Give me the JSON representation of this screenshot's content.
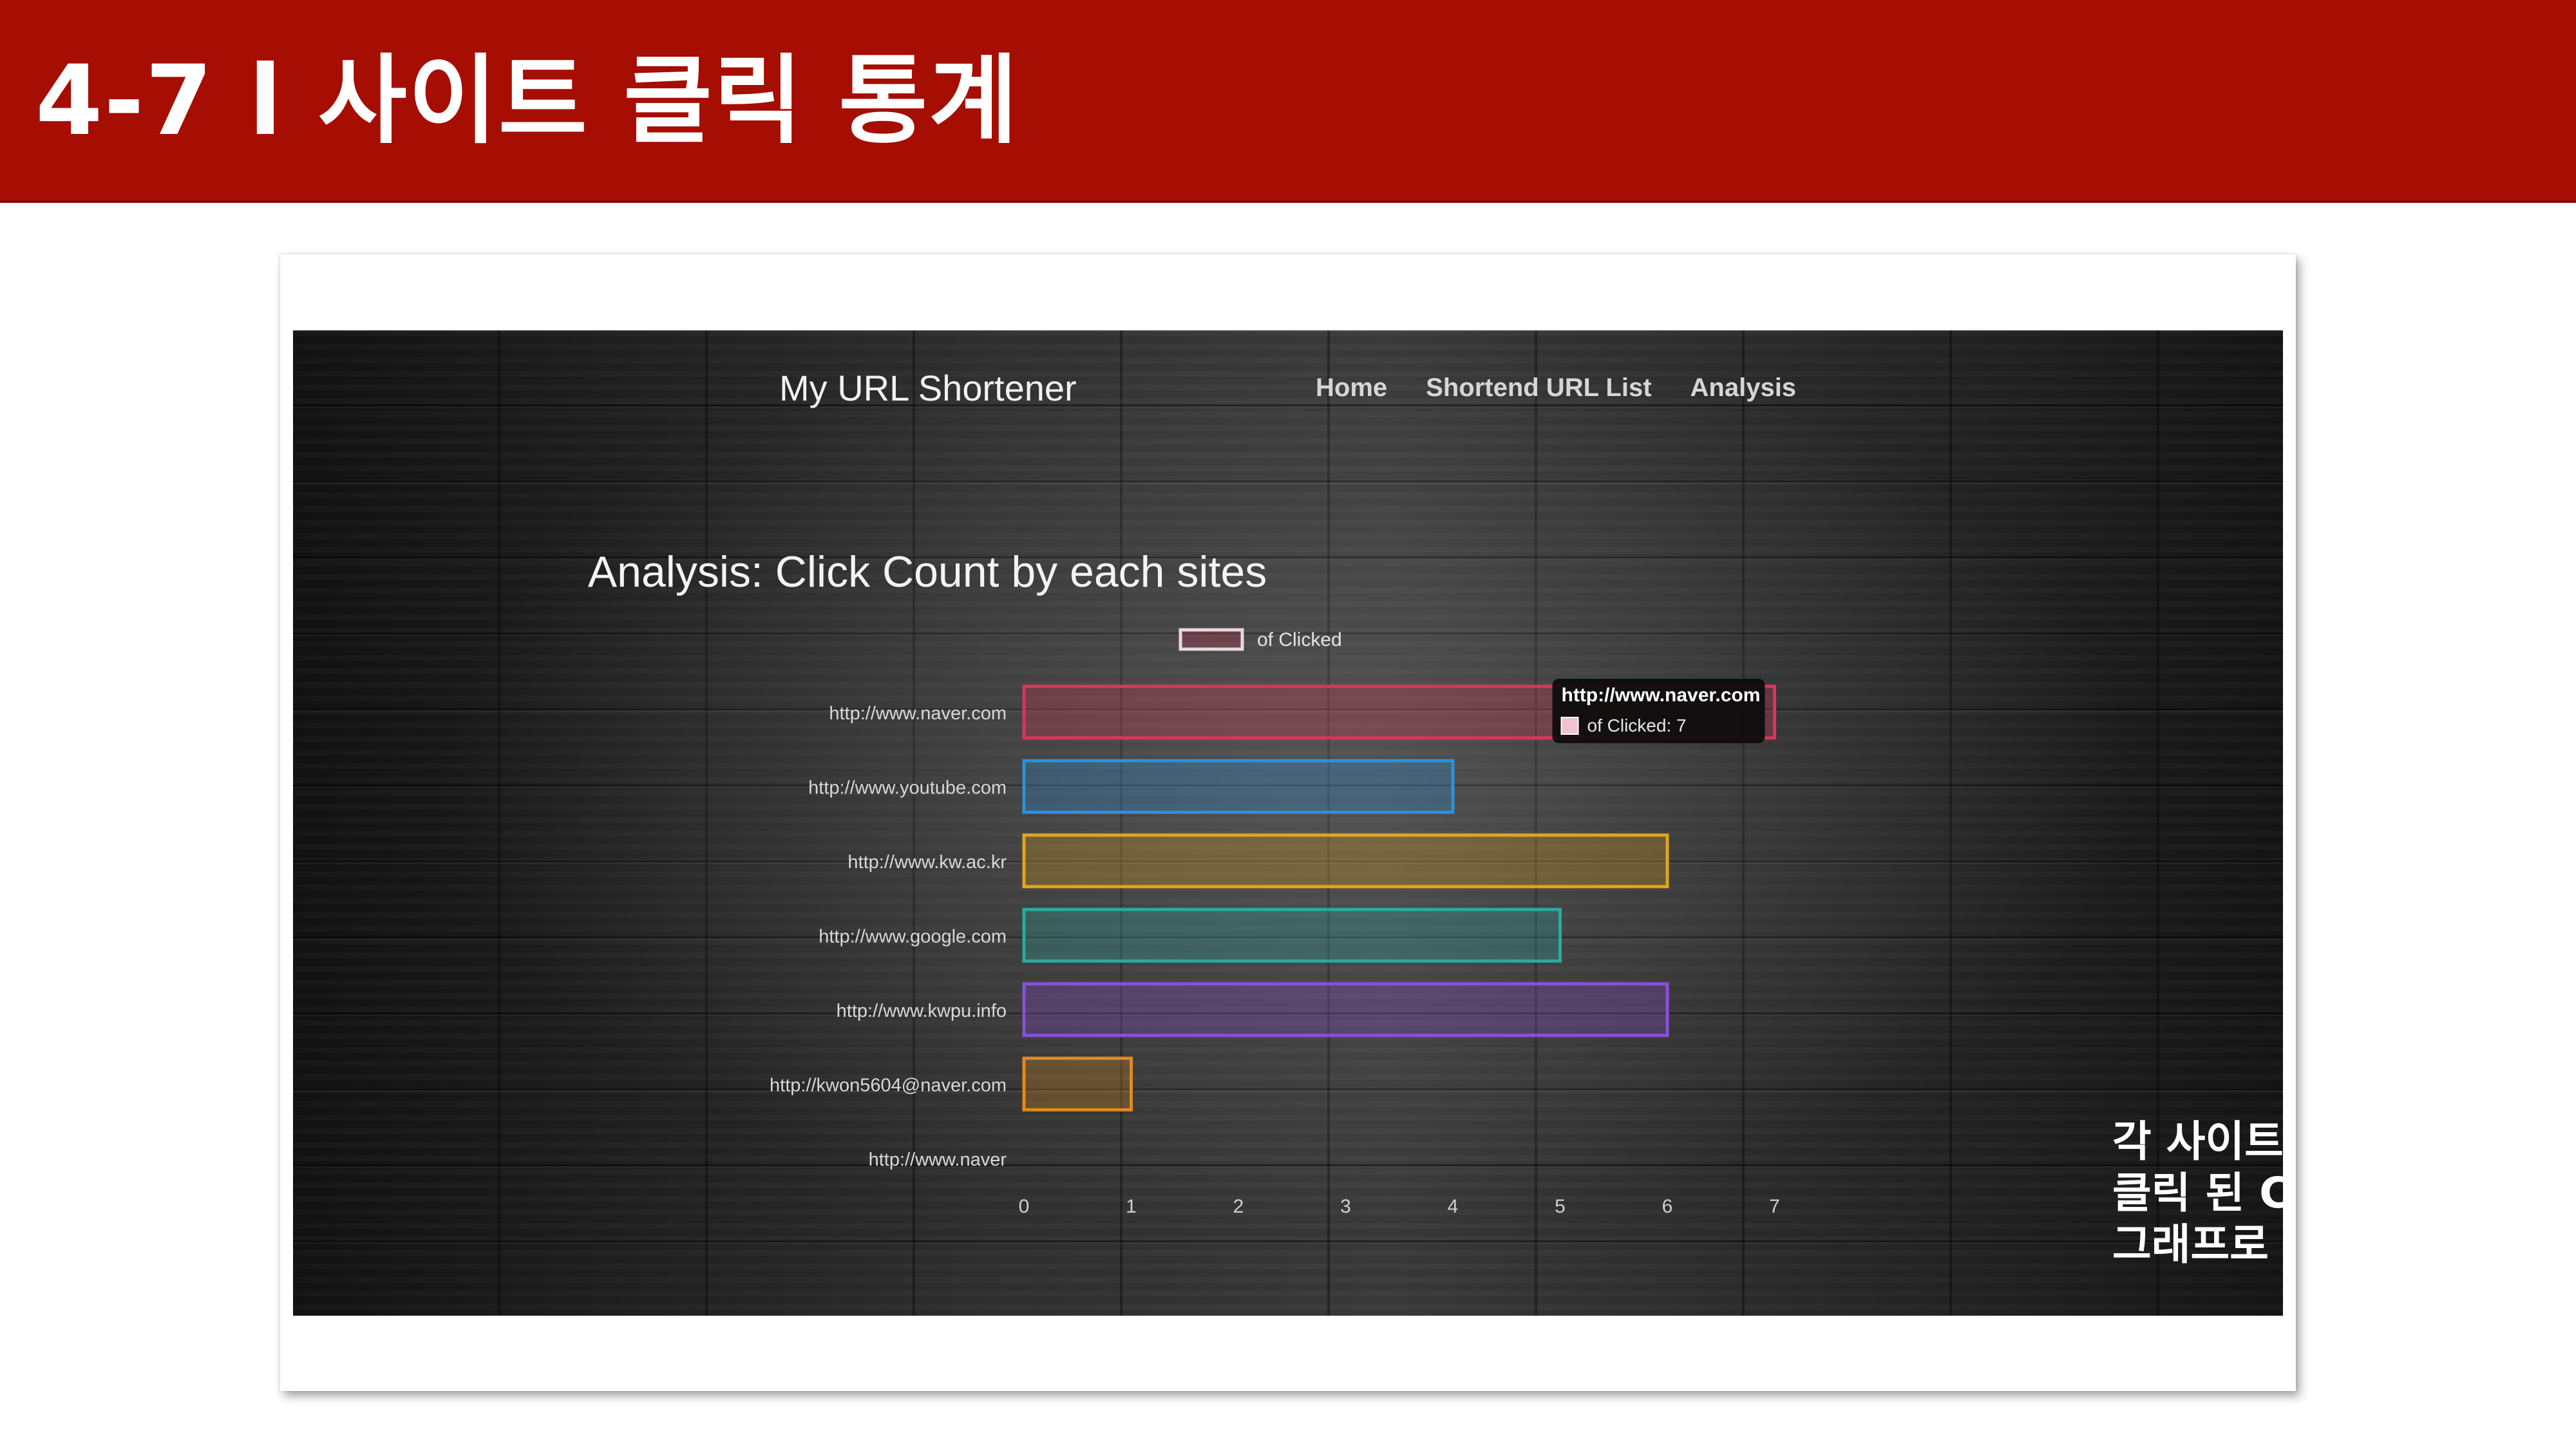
{
  "slide": {
    "title": "4-7 l 사이트 클릭 통계"
  },
  "app": {
    "brand": "My URL Shortener",
    "nav": [
      "Home",
      "Shortend URL List",
      "Analysis"
    ]
  },
  "chart_data": {
    "type": "bar",
    "orientation": "horizontal",
    "title": "Analysis: Click Count by each sites",
    "categories": [
      "http://www.naver.com",
      "http://www.youtube.com",
      "http://www.kw.ac.kr",
      "http://www.google.com",
      "http://www.kwpu.info",
      "http://kwon5604@naver.com",
      "http://www.naver"
    ],
    "series": [
      {
        "name": "of Clicked",
        "values": [
          7,
          4,
          6,
          5,
          6,
          1,
          0
        ]
      }
    ],
    "colors": [
      "#d8365b",
      "#2f90d8",
      "#e0a51e",
      "#2aaaa0",
      "#8a4fd8",
      "#e08a1e",
      "#999999"
    ],
    "xlim": [
      0,
      7
    ],
    "xticks": [
      0,
      1,
      2,
      3,
      4,
      5,
      6,
      7
    ],
    "legend_position": "top-center",
    "tooltip": {
      "title": "http://www.naver.com",
      "label": "of Clicked: 7"
    }
  },
  "callout": [
    "각 사이트 마다",
    "클릭 된 Count를",
    "그래프로 보여준다."
  ]
}
